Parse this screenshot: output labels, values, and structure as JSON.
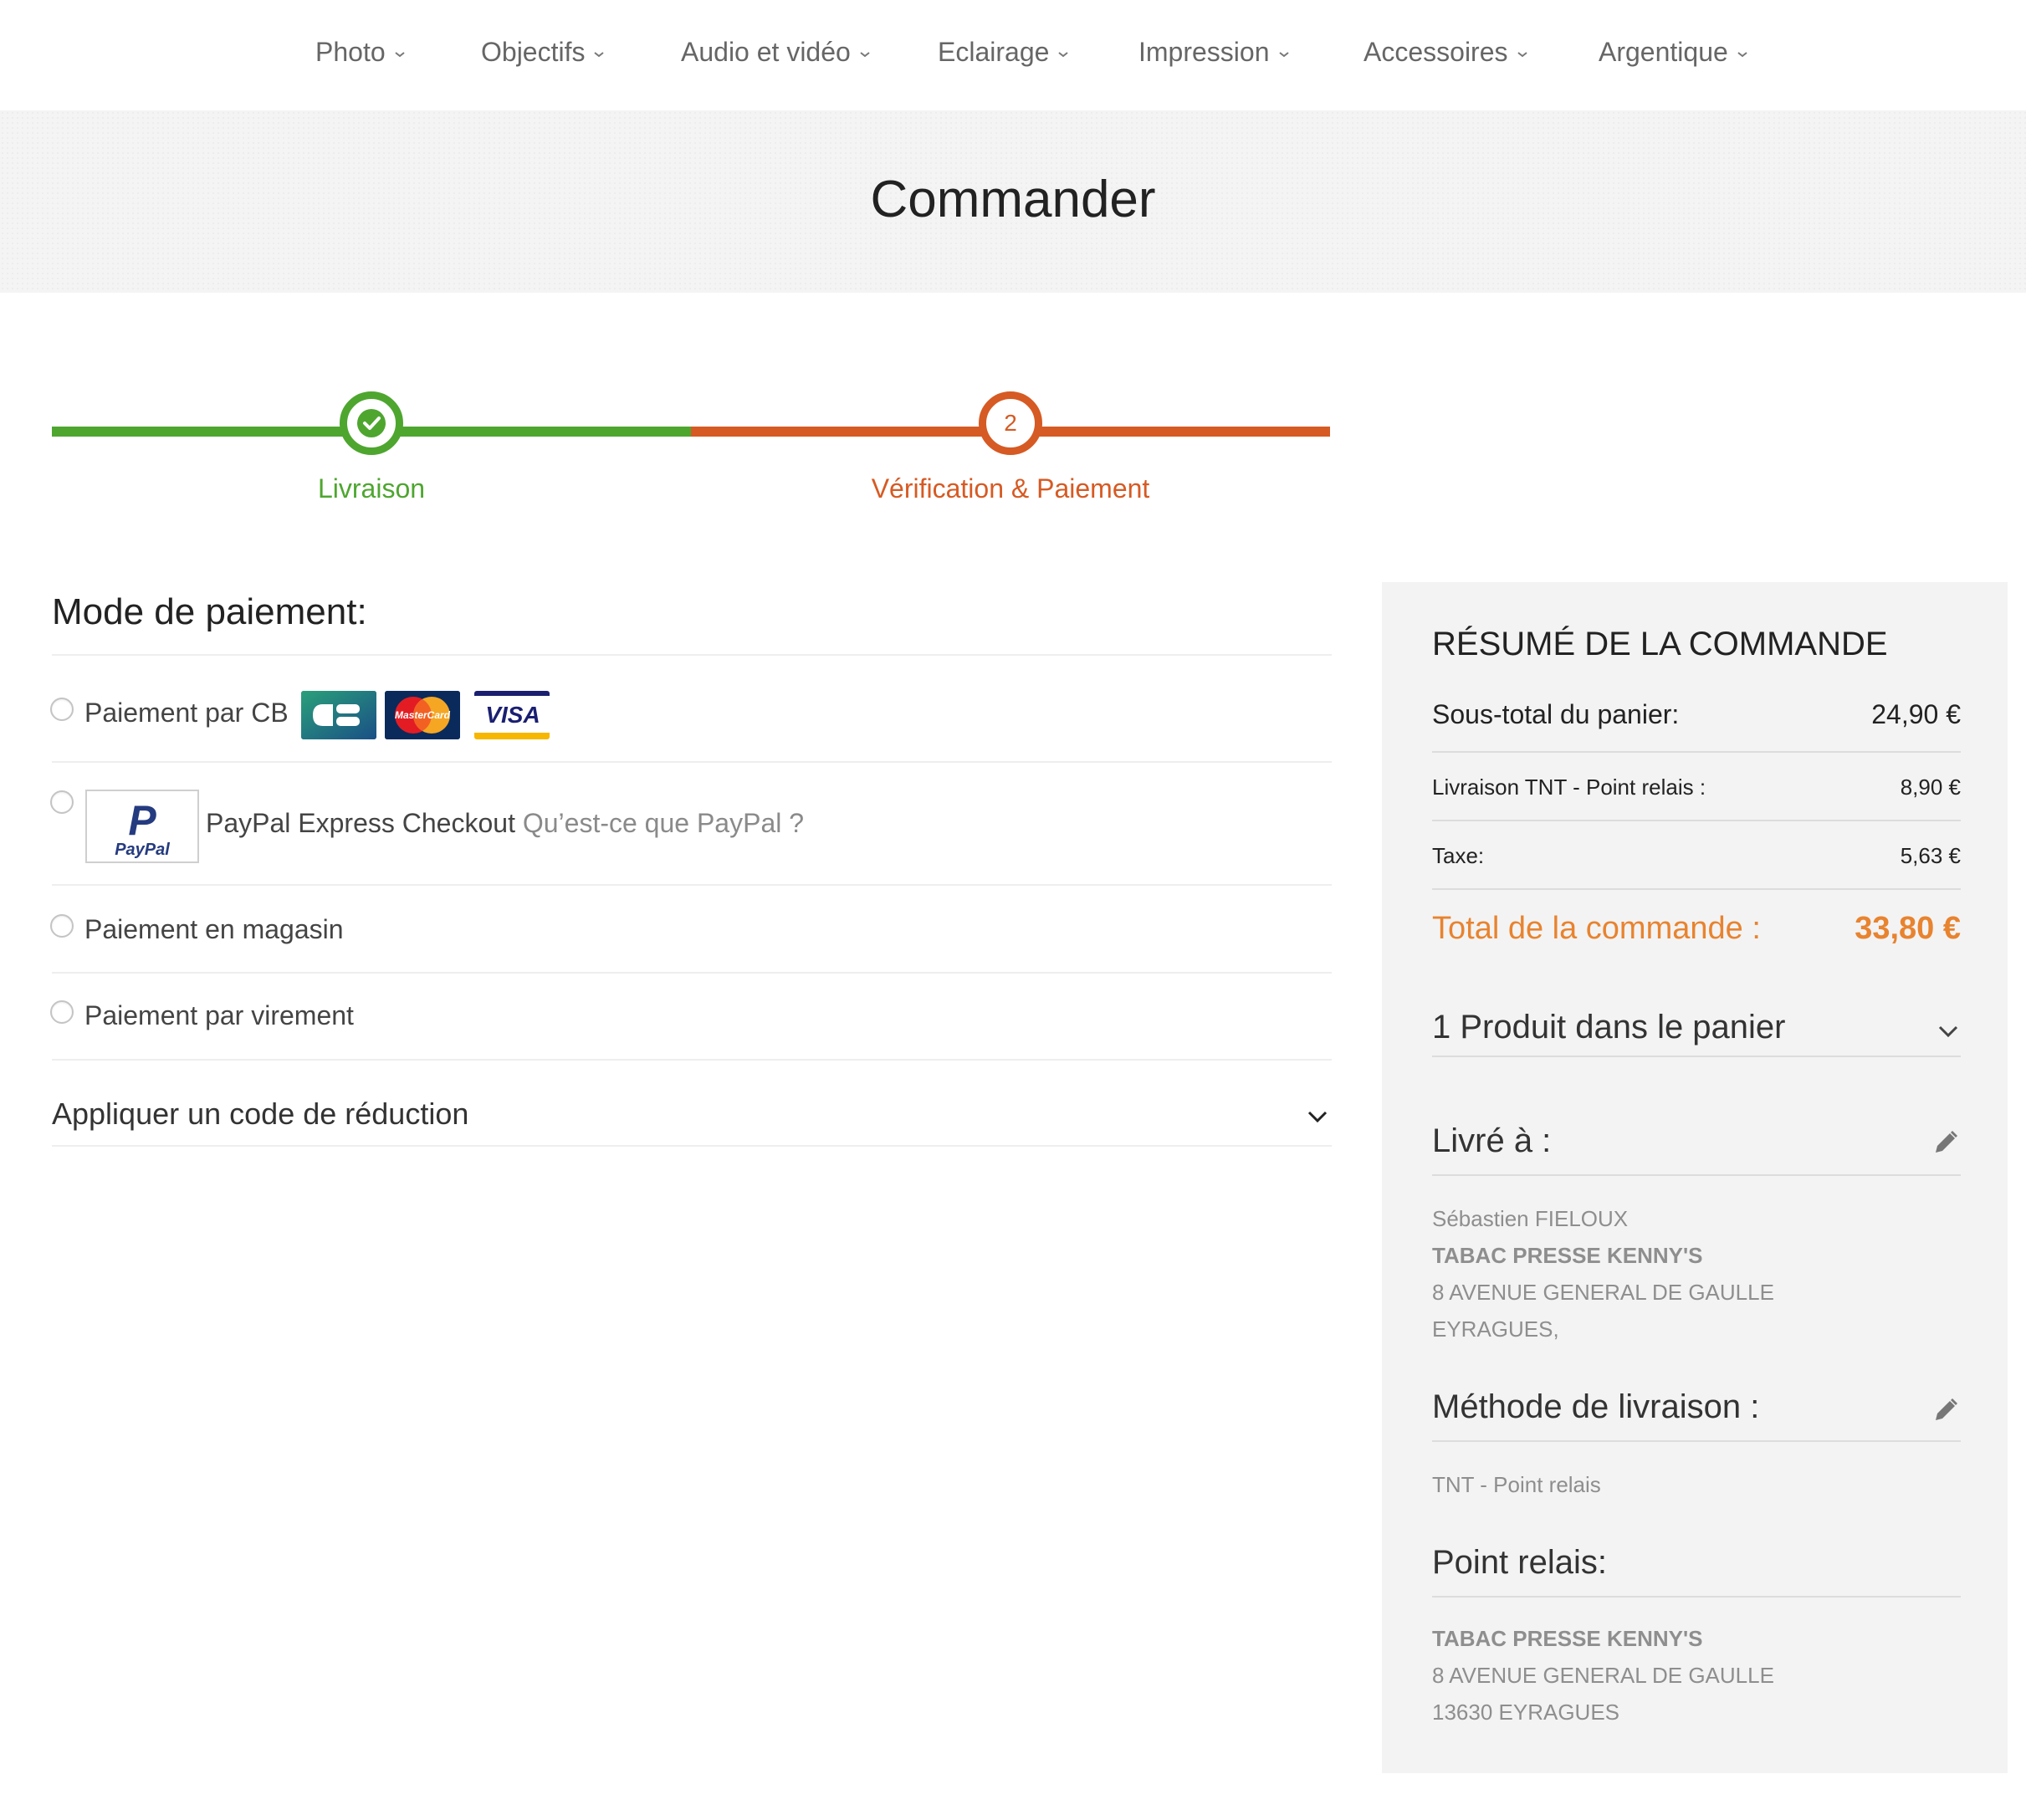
{
  "nav": {
    "items": [
      {
        "label": "Photo"
      },
      {
        "label": "Objectifs"
      },
      {
        "label": "Audio et vidéo"
      },
      {
        "label": "Eclairage"
      },
      {
        "label": "Impression"
      },
      {
        "label": "Accessoires"
      },
      {
        "label": "Argentique"
      }
    ]
  },
  "page": {
    "title": "Commander"
  },
  "colors": {
    "green": "#4ea62f",
    "orange": "#d65a23",
    "total_orange": "#e8832f"
  },
  "stepper": {
    "step1": {
      "label": "Livraison",
      "state": "complete",
      "icon": "check-icon"
    },
    "step2": {
      "number": "2",
      "label": "Vérification & Paiement",
      "state": "current"
    }
  },
  "payment": {
    "title": "Mode de paiement:",
    "options": {
      "cb": {
        "label": "Paiement par CB",
        "cards": [
          "CB",
          "MasterCard",
          "VISA"
        ]
      },
      "paypal": {
        "label": "PayPal Express Checkout",
        "link": "Qu’est-ce que PayPal ?",
        "logo_text": "PayPal",
        "logo_letter": "P"
      },
      "magasin": {
        "label": "Paiement en magasin"
      },
      "virement": {
        "label": "Paiement par virement"
      }
    },
    "reduction": {
      "label": "Appliquer un code de réduction"
    }
  },
  "summary": {
    "title": "RÉSUMÉ DE LA COMMANDE",
    "subtotal": {
      "label": "Sous-total du panier:",
      "value": "24,90 €"
    },
    "shipping": {
      "label": "Livraison TNT - Point relais :",
      "value": "8,90 €"
    },
    "tax": {
      "label": "Taxe:",
      "value": "5,63 €"
    },
    "total": {
      "label": "Total de la commande :",
      "value": "33,80 €"
    },
    "products": {
      "label": "1 Produit dans le panier"
    },
    "delivered_to": {
      "label": "Livré à :",
      "name": "Sébastien FIELOUX",
      "company": "TABAC PRESSE KENNY'S",
      "street": "8 AVENUE GENERAL DE GAULLE",
      "city": "EYRAGUES,"
    },
    "shipping_method": {
      "label": "Méthode de livraison :",
      "value": "TNT - Point relais"
    },
    "relay_point": {
      "label": "Point relais:",
      "company": "TABAC PRESSE KENNY'S",
      "street": "8 AVENUE GENERAL DE GAULLE",
      "city": "13630 EYRAGUES"
    }
  }
}
